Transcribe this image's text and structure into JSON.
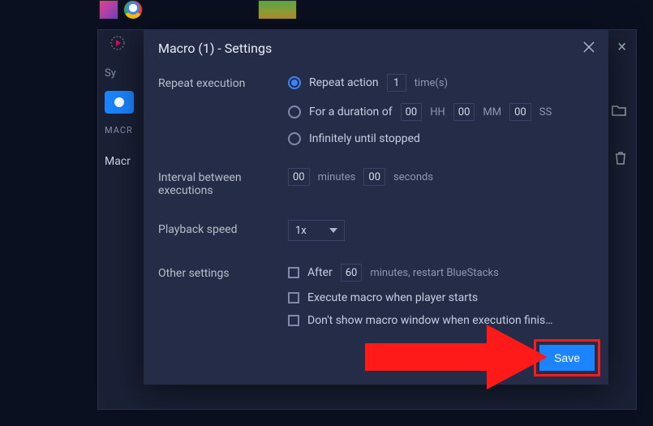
{
  "background": {
    "sy_label": "Sy",
    "macro_tab": "MACR",
    "macro_row": "Macr"
  },
  "dialog": {
    "title": "Macro (1) - Settings",
    "sections": {
      "repeat": {
        "label": "Repeat execution",
        "opt_action_prefix": "Repeat action",
        "opt_action_value": "1",
        "opt_action_suffix": "time(s)",
        "opt_duration_prefix": "For a duration of",
        "opt_duration_hh": "00",
        "opt_duration_hh_label": "HH",
        "opt_duration_mm": "00",
        "opt_duration_mm_label": "MM",
        "opt_duration_ss": "00",
        "opt_duration_ss_label": "SS",
        "opt_infinite": "Infinitely until stopped"
      },
      "interval": {
        "label": "Interval between executions",
        "minutes_value": "00",
        "minutes_label": "minutes",
        "seconds_value": "00",
        "seconds_label": "seconds"
      },
      "speed": {
        "label": "Playback speed",
        "value": "1x"
      },
      "other": {
        "label": "Other settings",
        "restart_prefix": "After",
        "restart_value": "60",
        "restart_suffix": "minutes, restart BlueStacks",
        "execute_on_start": "Execute macro when player starts",
        "dont_show": "Don't show macro window when execution finis…"
      }
    },
    "save": "Save"
  }
}
